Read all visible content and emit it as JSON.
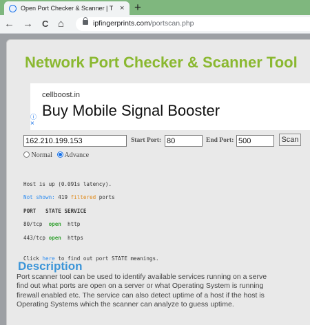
{
  "browser": {
    "tab_title": "Open Port Checker & Scanner | T",
    "tab_close": "×",
    "new_tab": "+",
    "url_host": "ipfingerprints.com",
    "url_path": "/portscan.php",
    "icons": {
      "back": "←",
      "forward": "→",
      "reload": "C",
      "home": "⌂"
    }
  },
  "page": {
    "headline": "Network Port Checker & Scanner Tool",
    "ad": {
      "domain": "cellboost.in",
      "headline": "Buy Mobile Signal Booster",
      "info_icon": "ⓘ",
      "close_icon": "×"
    },
    "form": {
      "host_value": "162.210.199.153",
      "start_port_label": "Start Port:",
      "start_port_value": "80",
      "end_port_label": "End Port:",
      "end_port_value": "500",
      "scan_label": "Scan",
      "mode_normal": "Normal",
      "mode_advance": "Advance",
      "selected_mode": "Advance"
    },
    "results": {
      "host_up": "Host is up (0.091s latency).",
      "not_shown_label": "Not shown:",
      "not_shown_count": "419",
      "filtered_word": "filtered",
      "ports_word": "ports",
      "col_port": "PORT",
      "col_state": "STATE",
      "col_service": "SERVICE",
      "rows": [
        {
          "port": "80/tcp",
          "state": "open",
          "service": "http"
        },
        {
          "port": "443/tcp",
          "state": "open",
          "service": "https"
        }
      ],
      "click_pre": "Click",
      "click_link": "here",
      "click_post": "to find out port STATE meanings."
    },
    "description": {
      "title": "Description",
      "lines": [
        "Port scanner tool can be used to identify available services running on a serve",
        "find out what ports are open on a server or what Operating System is running",
        "firewall enabled etc. The service can also detect uptime of a host if the host is",
        "Operating Systems which the scanner can analyze to guess uptime."
      ]
    },
    "colors": {
      "headline": "#8ab830",
      "description_title": "#3c95d8",
      "open_state": "#39a337",
      "filtered": "#e08a1a",
      "link": "#2d8cf0"
    }
  }
}
